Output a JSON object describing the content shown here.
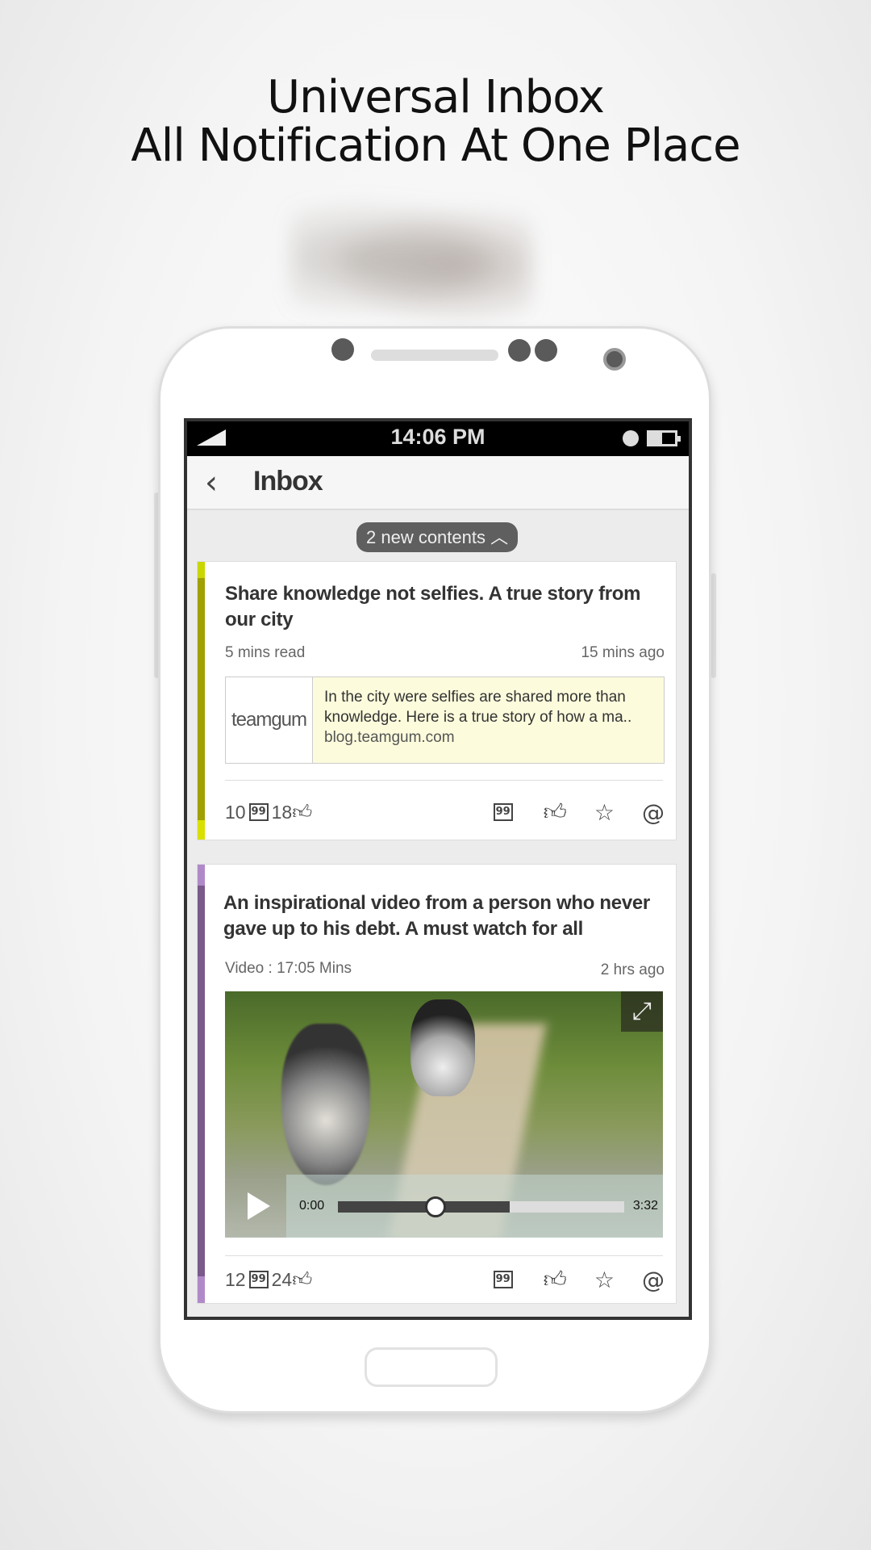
{
  "headline": {
    "line1": "Universal Inbox",
    "line2": "All Notification At One Place"
  },
  "status_bar": {
    "time": "14:06 PM"
  },
  "app_bar": {
    "title": "Inbox",
    "back_icon": "chevron-left-icon"
  },
  "new_contents": {
    "label": "2 new contents",
    "icon": "chevron-up-icon"
  },
  "cards": [
    {
      "accent": "#a8a800",
      "title": "Share knowledge not selfies. A true story from our city",
      "meta_left": "5 mins read",
      "meta_right": "15 mins ago",
      "link": {
        "logo": "teamgum",
        "text": "In the city were selfies are shared more than knowledge. Here is a true story of how a ma..",
        "domain": "blog.teamgum.com"
      },
      "comments": "10",
      "likes": "18"
    },
    {
      "accent": "#7a5a8a",
      "title": "An inspirational video from a person who never gave up to his debt. A must watch for all",
      "meta_left": "Video : 17:05 Mins",
      "meta_right": "2 hrs ago",
      "video": {
        "current": "0:00",
        "duration": "3:32",
        "progress_percent": 34,
        "buffered_percent": 60
      },
      "comments": "12",
      "likes": "24"
    }
  ],
  "actions": {
    "comment_icon": "quote-bubble-icon",
    "like_icon": "thumbs-up-icon",
    "star_icon": "star-icon",
    "at_icon": "at-icon",
    "at": "@",
    "star": "☆",
    "like": "👍︎"
  }
}
